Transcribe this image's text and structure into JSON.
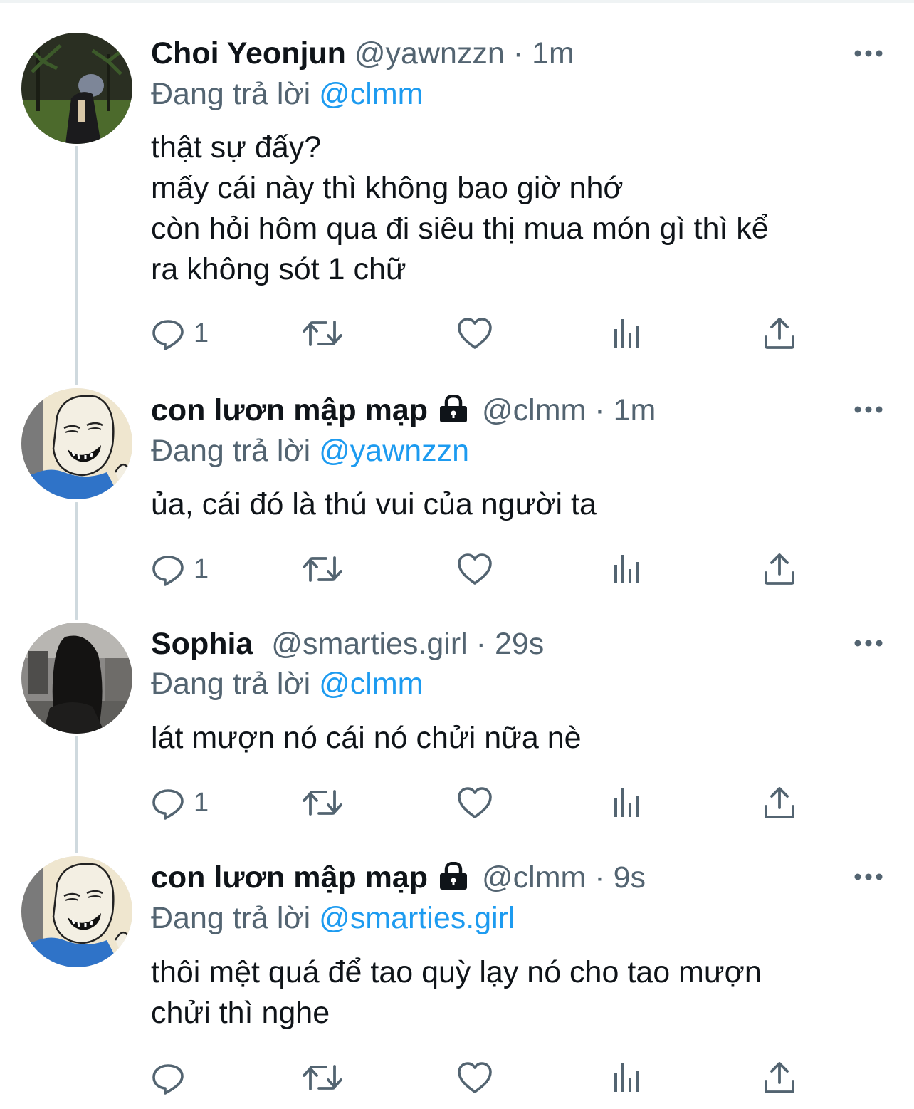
{
  "tweets": [
    {
      "name": "Choi Yeonjun",
      "handle": "@yawnzzn",
      "separator": "·",
      "time": "1m",
      "locked": false,
      "reply_prefix": "Đang trả lời",
      "reply_to": "@clmm",
      "lines": [
        "thật sự đấy?",
        "mấy cái này thì không bao giờ nhớ",
        "còn hỏi hôm qua đi siêu thị mua món gì thì kể",
        "ra không sót 1 chữ"
      ],
      "reply_count": "1"
    },
    {
      "name": "con lươn mập mạp",
      "handle": "@clmm",
      "separator": "·",
      "time": "1m",
      "locked": true,
      "reply_prefix": "Đang trả lời",
      "reply_to": "@yawnzzn",
      "lines": [
        "ủa, cái đó là thú vui của người ta"
      ],
      "reply_count": "1"
    },
    {
      "name": "Sophia",
      "handle": "@smarties.girl",
      "separator": "·",
      "time": "29s",
      "locked": false,
      "reply_prefix": "Đang trả lời",
      "reply_to": "@clmm",
      "lines": [
        "lát mượn nó cái nó chửi nữa nè"
      ],
      "reply_count": "1"
    },
    {
      "name": "con lươn mập mạp",
      "handle": "@clmm",
      "separator": "·",
      "time": "9s",
      "locked": true,
      "reply_prefix": "Đang trả lời",
      "reply_to": "@smarties.girl",
      "lines": [
        "thôi mệt quá để tao quỳ lạy nó cho tao mượn",
        "chửi thì nghe"
      ],
      "reply_count": ""
    }
  ],
  "icons": {
    "reply": "reply-icon",
    "retweet": "retweet-icon",
    "like": "like-icon",
    "views": "views-icon",
    "share": "share-icon",
    "more": "more-icon",
    "lock": "lock-icon"
  },
  "colors": {
    "text": "#0f1419",
    "muted": "#536471",
    "link": "#1d9bf0",
    "thread_line": "#cfd9de"
  }
}
